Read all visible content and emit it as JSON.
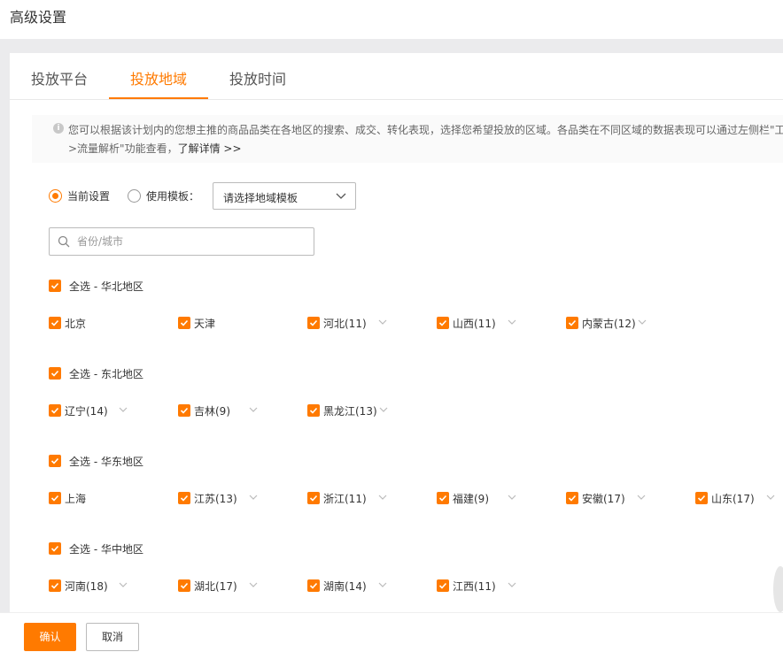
{
  "page": {
    "title": "高级设置"
  },
  "tabs": [
    {
      "label": "投放平台",
      "active": false
    },
    {
      "label": "投放地域",
      "active": true
    },
    {
      "label": "投放时间",
      "active": false
    }
  ],
  "info": {
    "line1": "您可以根据该计划内的您想主推的商品品类在各地区的搜索、成交、转化表现，选择您希望投放的区域。各品类在不同区域的数据表现可以通过左侧栏\"工",
    "line2_prefix": ">流量解析\"功能查看，",
    "line2_link": "了解详情 >>"
  },
  "settings": {
    "current_label": "当前设置",
    "template_label": "使用模板：",
    "selected": "current",
    "template_select": {
      "value": "请选择地域模板"
    }
  },
  "search": {
    "placeholder": "省份/城市",
    "value": ""
  },
  "regions": [
    {
      "select_all": "全选 - 华北地区",
      "provinces": [
        "北京",
        "天津",
        "河北(11)",
        "山西(11)",
        "内蒙古(12)"
      ]
    },
    {
      "select_all": "全选 - 东北地区",
      "provinces": [
        "辽宁(14)",
        "吉林(9)",
        "黑龙江(13)"
      ]
    },
    {
      "select_all": "全选 - 华东地区",
      "provinces": [
        "上海",
        "江苏(13)",
        "浙江(11)",
        "福建(9)",
        "安徽(17)",
        "山东(17)"
      ]
    },
    {
      "select_all": "全选 - 华中地区",
      "provinces": [
        "河南(18)",
        "湖北(17)",
        "湖南(14)",
        "江西(11)"
      ]
    }
  ],
  "footer": {
    "confirm": "确认",
    "cancel": "取消"
  },
  "colors": {
    "accent": "#ff7a00",
    "background": "#ebebed",
    "text": "#333333"
  },
  "icons": {
    "info": "info-circle-icon",
    "search": "search-icon",
    "expand": "chevron-down-icon",
    "check": "check-icon"
  }
}
